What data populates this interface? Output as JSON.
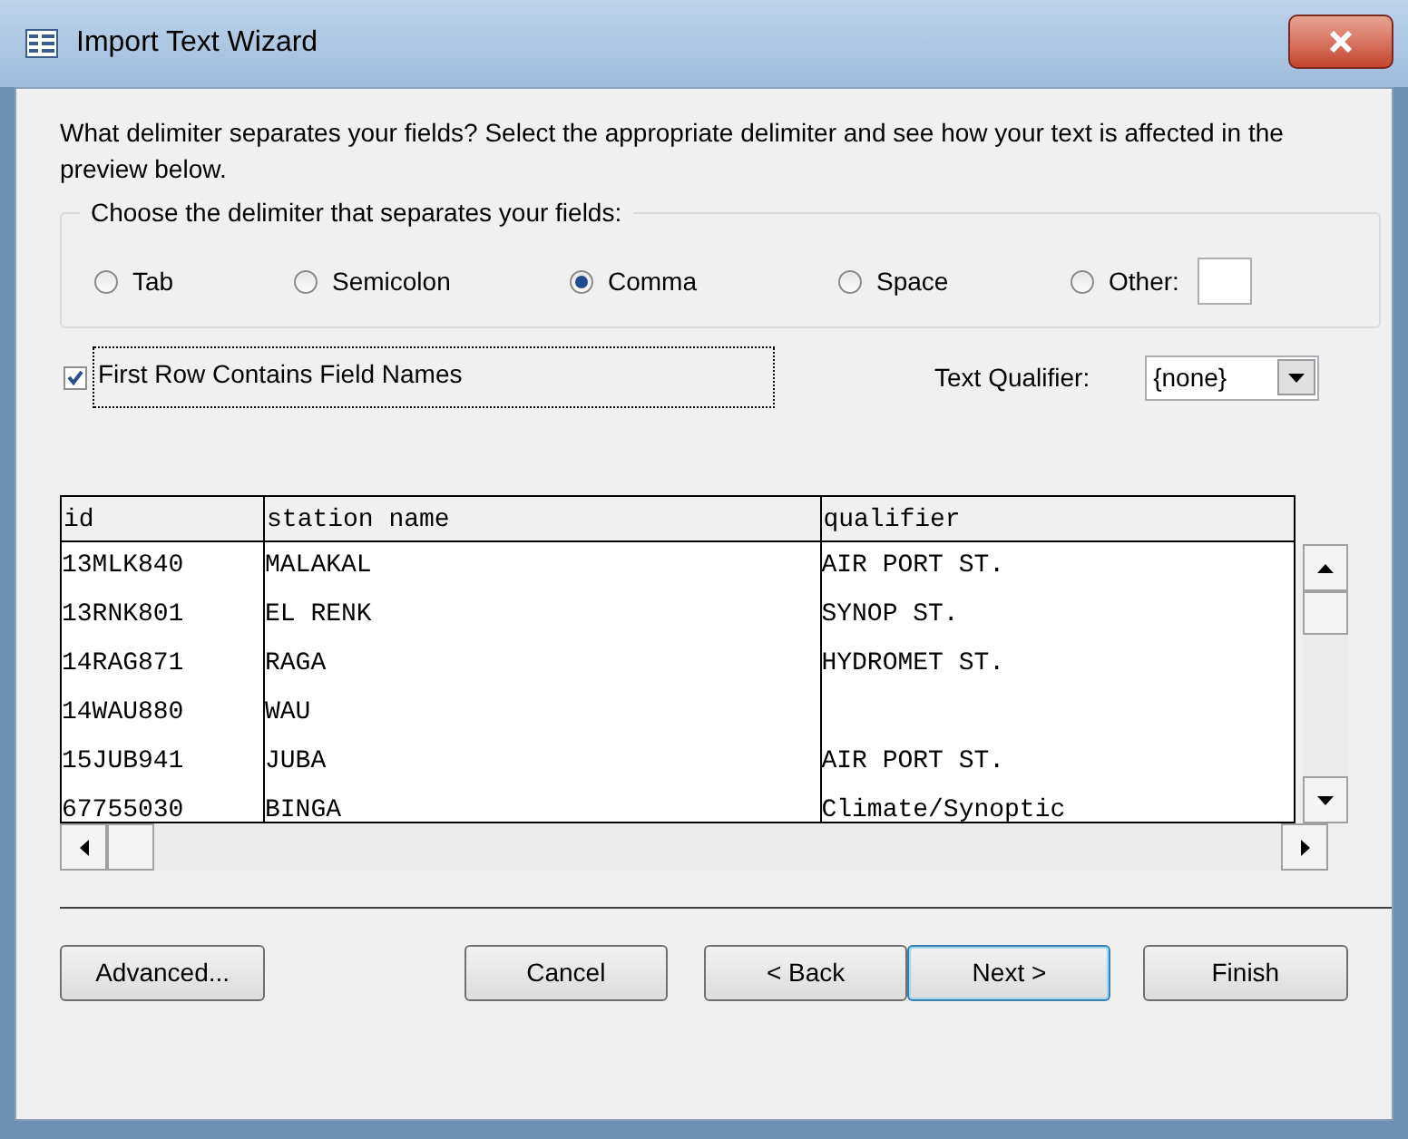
{
  "window": {
    "title": "Import Text Wizard"
  },
  "instructions": "What delimiter separates your fields? Select the appropriate delimiter and see how your text is affected in the preview below.",
  "delimiter_group": {
    "label": "Choose the delimiter that separates your fields:",
    "options": [
      {
        "label": "Tab",
        "selected": false
      },
      {
        "label": "Semicolon",
        "selected": false
      },
      {
        "label": "Comma",
        "selected": true
      },
      {
        "label": "Space",
        "selected": false
      },
      {
        "label": "Other:",
        "selected": false
      }
    ]
  },
  "first_row_names": {
    "label": "First Row Contains Field Names",
    "checked": true
  },
  "text_qualifier": {
    "label": "Text Qualifier:",
    "value": "{none}"
  },
  "preview": {
    "columns": [
      "id",
      "station name",
      "qualifier"
    ],
    "rows": [
      [
        "13MLK840",
        "MALAKAL",
        "AIR PORT ST."
      ],
      [
        "13RNK801",
        "EL RENK",
        "SYNOP ST."
      ],
      [
        "14RAG871",
        "RAGA",
        "HYDROMET ST."
      ],
      [
        "14WAU880",
        "WAU",
        ""
      ],
      [
        "15JUB941",
        "JUBA",
        "AIR PORT ST."
      ],
      [
        "67755030",
        "BINGA",
        "Climate/Synoptic"
      ]
    ]
  },
  "buttons": [
    {
      "label": "Advanced...",
      "default": false
    },
    {
      "label": "Cancel",
      "default": false
    },
    {
      "label": "< Back",
      "default": false
    },
    {
      "label": "Next >",
      "default": true
    },
    {
      "label": "Finish",
      "default": false
    }
  ]
}
